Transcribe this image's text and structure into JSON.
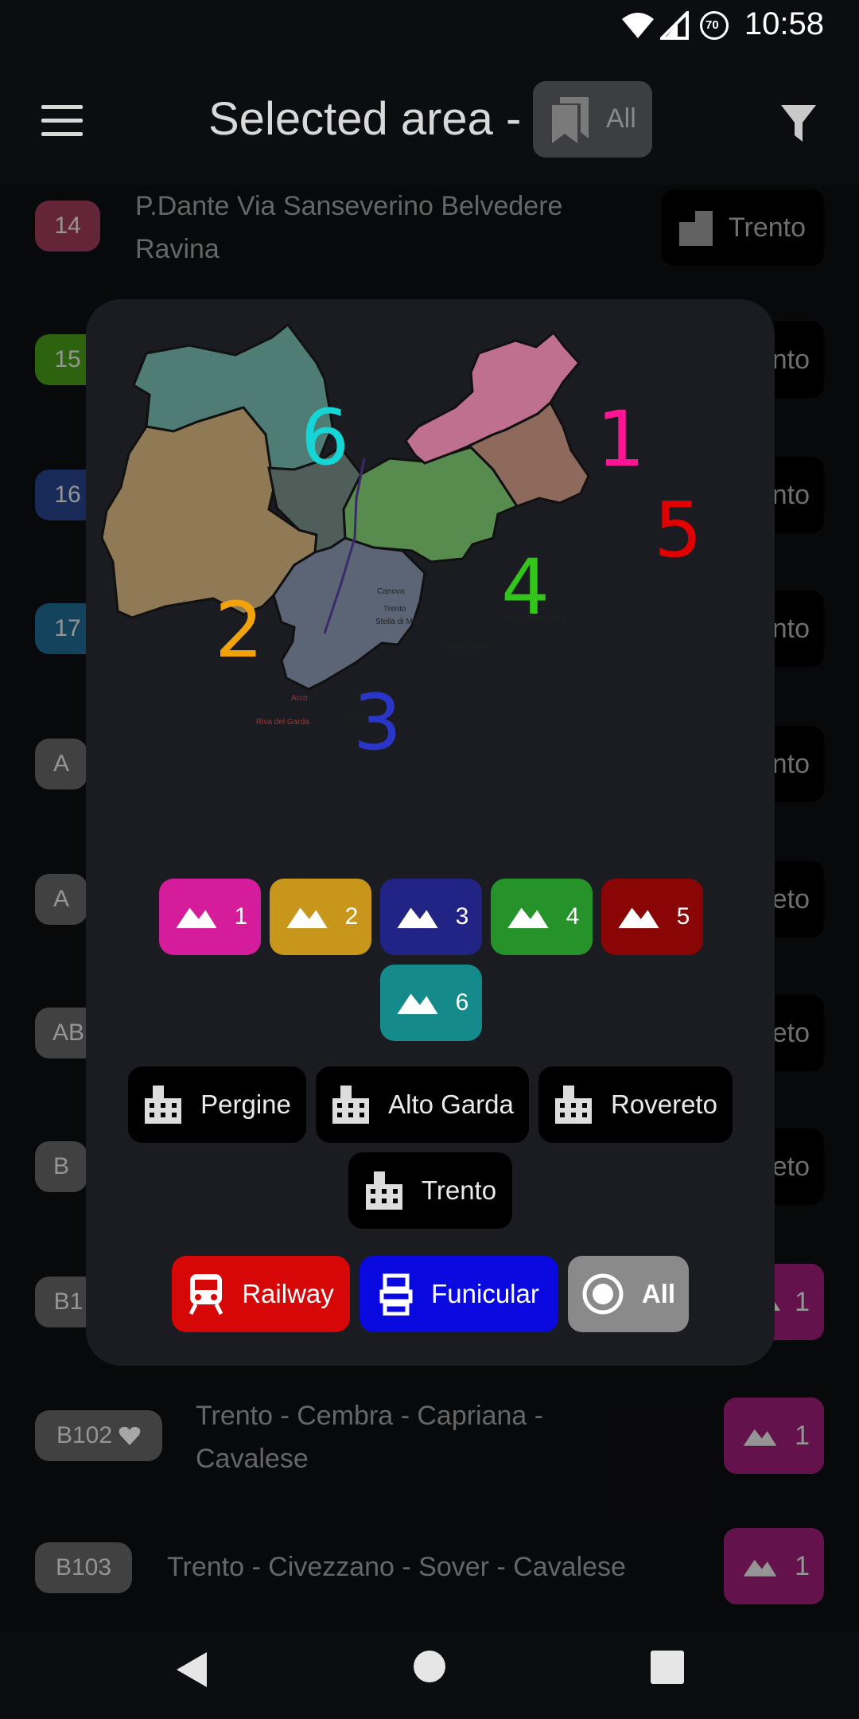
{
  "status_bar": {
    "time": "10:58",
    "battery_level": "70"
  },
  "app_bar": {
    "title": "Selected area -",
    "area_chip_label": "All"
  },
  "list": [
    {
      "code": "14",
      "badge_color": "#8b3450",
      "text_line1": "P.Dante Via Sanseverino Belvedere",
      "text_line2": "Ravina",
      "right_label": "Trento"
    },
    {
      "code": "15",
      "badge_color": "#3f8a16",
      "right_label": "nto"
    },
    {
      "code": "16",
      "badge_color": "#223c7a",
      "right_label": "nto"
    },
    {
      "code": "17",
      "badge_color": "#1c5f82",
      "right_label": "nto"
    },
    {
      "code": "A",
      "badge_color": "#5a5a5a",
      "right_label": "nto"
    },
    {
      "code": "A",
      "badge_color": "#5a5a5a",
      "right_label": "eto"
    },
    {
      "code": "AB",
      "badge_color": "#5a5a5a",
      "right_label": "eto"
    },
    {
      "code": "B",
      "badge_color": "#5a5a5a",
      "right_label": "eto"
    },
    {
      "code": "B1",
      "badge_color": "#5a5a5a",
      "right_label": "1"
    },
    {
      "code": "B102",
      "badge_color": "#5a5a5a",
      "favorite": true,
      "text_line1": "Trento -  Cembra - Capriana -",
      "text_line2": "Cavalese",
      "right_label": "1"
    },
    {
      "code": "B103",
      "badge_color": "#5a5a5a",
      "text_line1": "Trento - Civezzano - Sover - Cavalese",
      "right_label": "1"
    }
  ],
  "dialog": {
    "map": {
      "zones": [
        {
          "number": "1",
          "color": "#ff1493"
        },
        {
          "number": "2",
          "color": "#f2a30a"
        },
        {
          "number": "3",
          "color": "#2a36c8"
        },
        {
          "number": "4",
          "color": "#33c61a"
        },
        {
          "number": "5",
          "color": "#e00000"
        },
        {
          "number": "6",
          "color": "#14d6d6"
        }
      ],
      "place_labels": [
        "Canova",
        "Trento",
        "Stella di Mori",
        "Borgo Valsugana",
        "Levico Terme",
        "Arco",
        "Riva del Garda",
        "Chiusole",
        "Rovereto"
      ]
    },
    "zone_buttons": [
      {
        "label": "1",
        "color": "#d51d9b"
      },
      {
        "label": "2",
        "color": "#c7961a"
      },
      {
        "label": "3",
        "color": "#212385"
      },
      {
        "label": "4",
        "color": "#25932a"
      },
      {
        "label": "5",
        "color": "#8a0505"
      },
      {
        "label": "6",
        "color": "#158a8a"
      }
    ],
    "city_buttons": [
      "Pergine",
      "Alto Garda",
      "Rovereto",
      "Trento"
    ],
    "type_buttons": [
      {
        "label": "Railway",
        "color": "#d60707"
      },
      {
        "label": "Funicular",
        "color": "#0a0ae0"
      },
      {
        "label": "All",
        "color": "#8a8a8a"
      }
    ]
  }
}
